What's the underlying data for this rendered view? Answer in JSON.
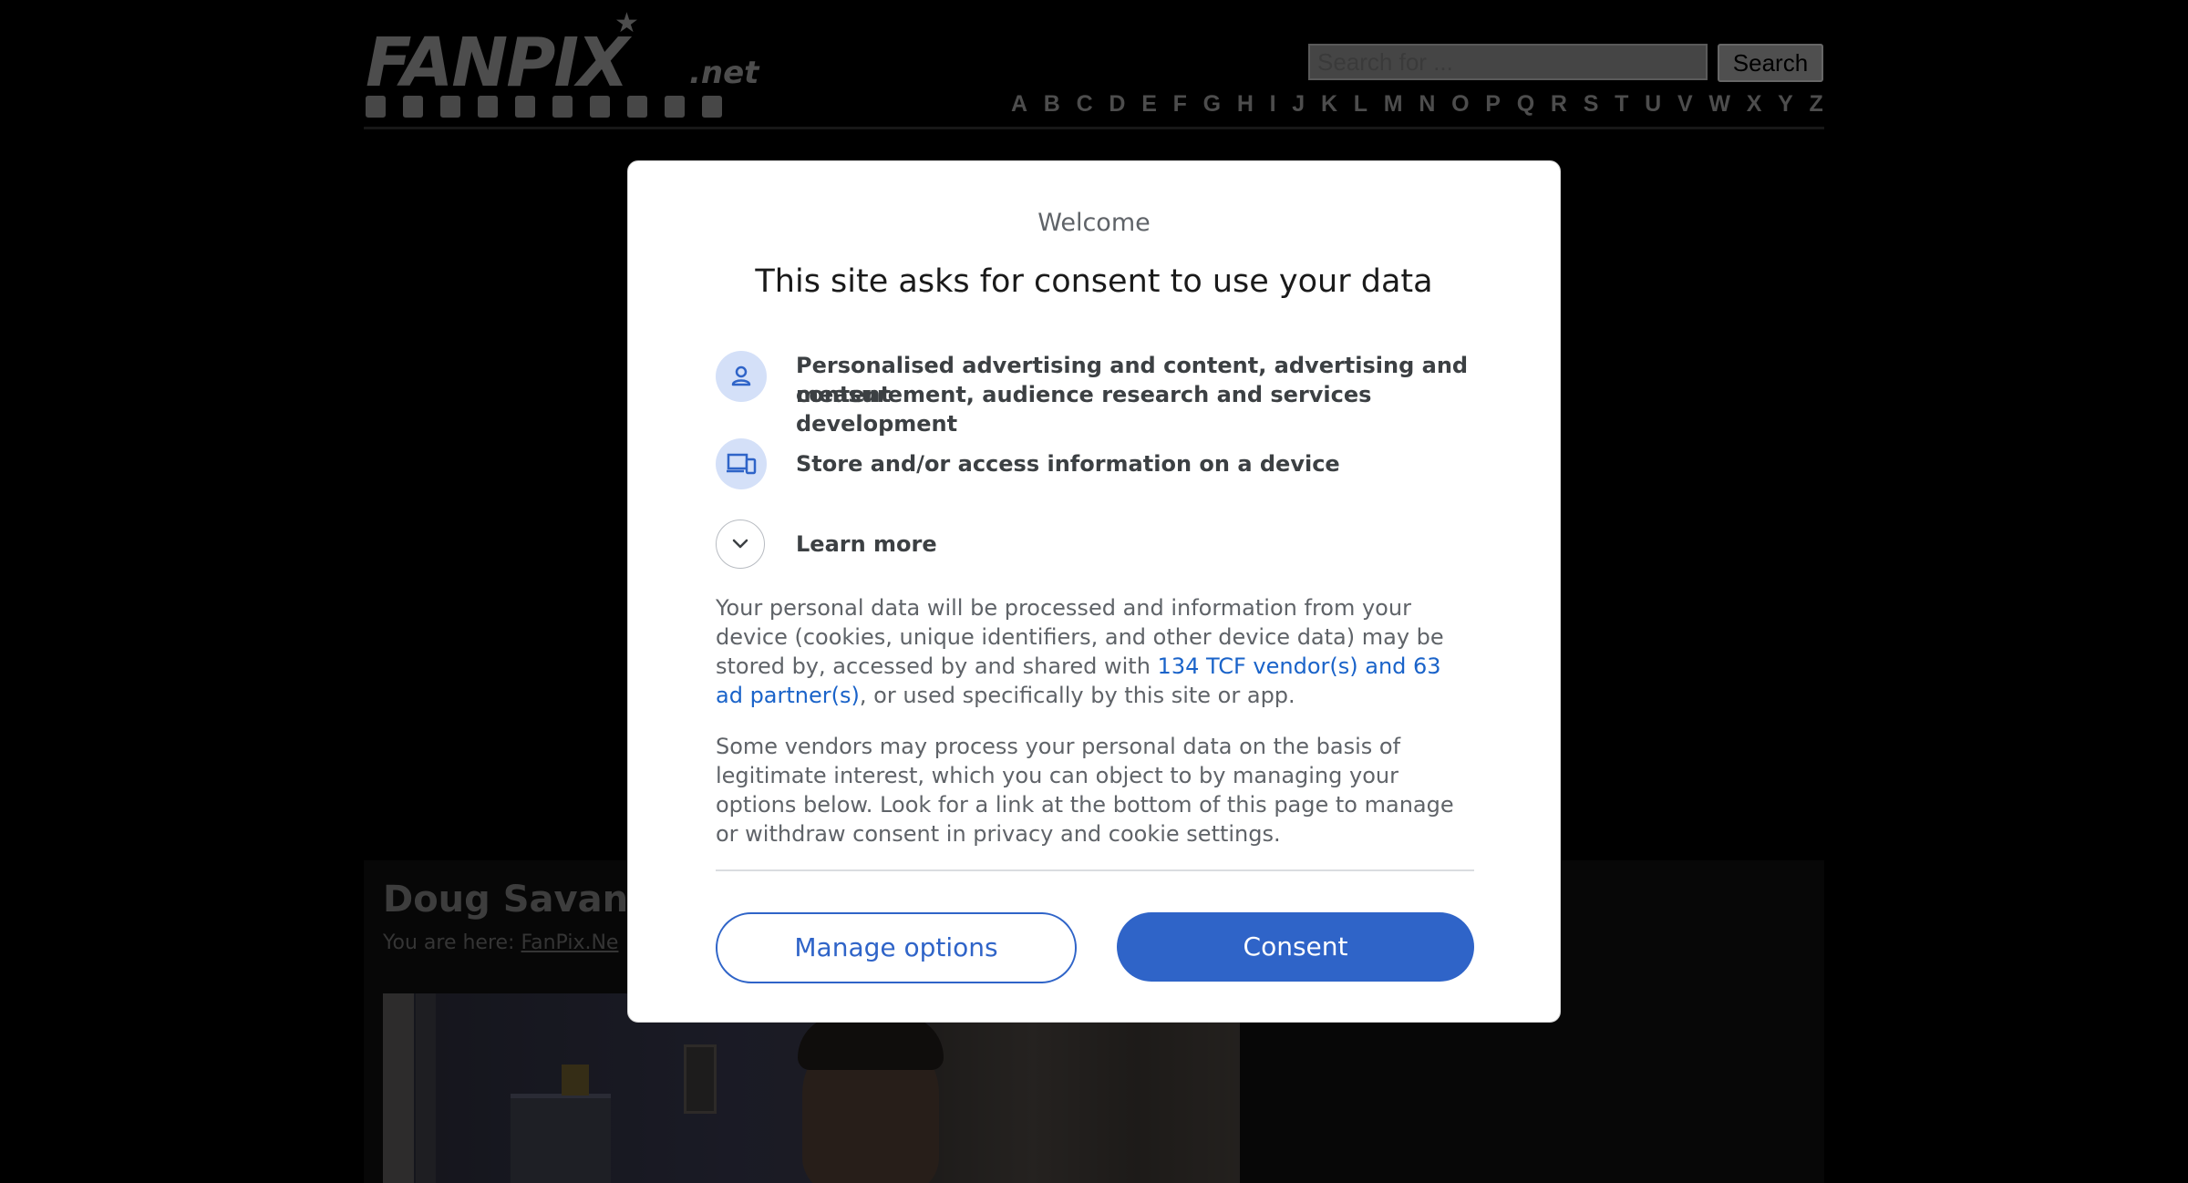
{
  "site": {
    "logo_text": "FANPIX",
    "logo_suffix": ".net",
    "search": {
      "placeholder": "Search for ...",
      "button_label": "Search"
    },
    "alphabet": [
      "A",
      "B",
      "C",
      "D",
      "E",
      "F",
      "G",
      "H",
      "I",
      "J",
      "K",
      "L",
      "M",
      "N",
      "O",
      "P",
      "Q",
      "R",
      "S",
      "T",
      "U",
      "V",
      "W",
      "X",
      "Y",
      "Z"
    ],
    "page_title": "Doug Savan",
    "breadcrumb_prefix": "You are here:",
    "breadcrumb_link": "FanPix.Ne"
  },
  "dialog": {
    "welcome": "Welcome",
    "title": "This site asks for consent to use your data",
    "purposes": [
      {
        "icon": "person-icon",
        "label_line1": "Personalised advertising and content, advertising and content",
        "label_line2": "measurement, audience research and services development"
      },
      {
        "icon": "devices-icon",
        "label": "Store and/or access information on a device"
      }
    ],
    "learn_more": "Learn more",
    "para1_before_link": "Your personal data will be processed and information from your device (cookies, unique identifiers, and other device data) may be stored by, accessed by and shared with ",
    "para1_link": "134 TCF vendor(s) and 63 ad partner(s)",
    "para1_after_link": ", or used specifically by this site or app.",
    "para2": "Some vendors may process your personal data on the basis of legitimate interest, which you can object to by managing your options below. Look for a link at the bottom of this page to manage or withdraw consent in privacy and cookie settings.",
    "manage_button": "Manage options",
    "consent_button": "Consent"
  },
  "colors": {
    "accent": "#2f64c8",
    "icon_bg": "#d4e0f8",
    "overlay": "rgba(0,0,0,0.5)"
  }
}
